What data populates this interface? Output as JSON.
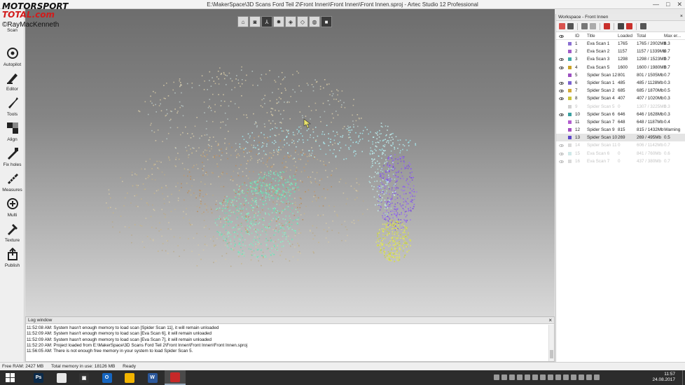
{
  "window": {
    "title": "E:\\MakerSpace\\3D Scans Ford Teil 2\\Front Innen\\Front Innen\\Front Innen.sproj - Artec Studio 12 Professional",
    "controls": [
      "—",
      "□",
      "✕"
    ]
  },
  "watermark": {
    "logo_line1": "MOTORSPORT",
    "logo_line2": "TOTAL.com",
    "credit": "©RayMacKenneth"
  },
  "left_toolbar": [
    {
      "label": "Scan",
      "icon": "scan-icon"
    },
    {
      "label": "Autopilot",
      "icon": "autopilot-icon"
    },
    {
      "label": "Editor",
      "icon": "editor-icon"
    },
    {
      "label": "Tools",
      "icon": "tools-icon"
    },
    {
      "label": "Align",
      "icon": "align-icon"
    },
    {
      "label": "Fix holes",
      "icon": "fix-holes-icon"
    },
    {
      "label": "Measures",
      "icon": "measures-icon"
    },
    {
      "label": "Multi",
      "icon": "multi-icon"
    },
    {
      "label": "Texture",
      "icon": "texture-icon"
    },
    {
      "label": "Publish",
      "icon": "publish-icon"
    }
  ],
  "view_toolbar": [
    "home-view-icon",
    "camera-icon",
    "axes-icon",
    "light-icon",
    "shaded-cube-icon",
    "wire-cube-icon",
    "sphere-icon",
    "solid-cube-icon"
  ],
  "log": {
    "title": "Log window",
    "close": "×",
    "lines": [
      "11:52:08 AM: System hasn't enough memory to load scan [Spider Scan 11], it will remain unloaded",
      "11:52:09 AM: System hasn't enough memory to load scan [Eva Scan 6], it will remain unloaded",
      "11:52:09 AM: System hasn't enough memory to load scan [Eva Scan 7], it will remain unloaded",
      "11:52:20 AM: Project loaded from E:\\MakerSpace\\3D Scans Ford Teil 2\\Front Innen\\Front Innen\\Front Innen.sproj",
      "11:56:05 AM: There is not enough free memory in your system to load Spider Scan 5."
    ]
  },
  "status": {
    "free_ram": "Free RAM: 2427 MB",
    "total_mem": "Total memory in use: 18126 MB",
    "state": "Ready"
  },
  "workspace": {
    "title": "Workspace - Front Innen",
    "close": "×",
    "columns": {
      "id": "ID",
      "title": "Title",
      "loaded": "Loaded",
      "total": "Total",
      "max": "Max er..."
    },
    "rows": [
      {
        "visible": false,
        "color": "#8a6fd1",
        "id": "1",
        "title": "Eva Scan 1",
        "loaded": "1765",
        "total": "1765 / 2002Mb",
        "max": "8.3",
        "faded": false,
        "selected": false
      },
      {
        "visible": false,
        "color": "#a05cc8",
        "id": "2",
        "title": "Eva Scan 2",
        "loaded": "1157",
        "total": "1157 / 1339Mb",
        "max": "0.7",
        "faded": false,
        "selected": false
      },
      {
        "visible": true,
        "color": "#3fa7a7",
        "id": "3",
        "title": "Eva Scan 3",
        "loaded": "1298",
        "total": "1298 / 1523Mb",
        "max": "0.7",
        "faded": false,
        "selected": false
      },
      {
        "visible": true,
        "color": "#c9a227",
        "id": "4",
        "title": "Eva Scan 5",
        "loaded": "1600",
        "total": "1600 / 1980Mb",
        "max": "0.7",
        "faded": false,
        "selected": false
      },
      {
        "visible": false,
        "color": "#9c4fc0",
        "id": "5",
        "title": "Spider Scan 12",
        "loaded": "801",
        "total": "801 / 1505Mb",
        "max": "0.7",
        "faded": false,
        "selected": false
      },
      {
        "visible": true,
        "color": "#7a62cf",
        "id": "6",
        "title": "Spider Scan 1",
        "loaded": "485",
        "total": "485 / 1128Mb",
        "max": "0.3",
        "faded": false,
        "selected": false
      },
      {
        "visible": true,
        "color": "#d1a93a",
        "id": "7",
        "title": "Spider Scan 2",
        "loaded": "685",
        "total": "685 / 1870Mb",
        "max": "0.5",
        "faded": false,
        "selected": false
      },
      {
        "visible": true,
        "color": "#c9c43a",
        "id": "8",
        "title": "Spider Scan 4",
        "loaded": "407",
        "total": "407 / 1020Mb",
        "max": "0.3",
        "faded": false,
        "selected": false
      },
      {
        "visible": false,
        "color": "#d0d0d0",
        "id": "9",
        "title": "Spider Scan 5",
        "loaded": "0",
        "total": "1307 / 3225Mb",
        "max": "0.3",
        "faded": true,
        "selected": false
      },
      {
        "visible": true,
        "color": "#3aa0a0",
        "id": "10",
        "title": "Spider Scan 6",
        "loaded": "646",
        "total": "646 / 1628Mb",
        "max": "0.3",
        "faded": false,
        "selected": false
      },
      {
        "visible": false,
        "color": "#b35fcf",
        "id": "11",
        "title": "Spider Scan 7",
        "loaded": "648",
        "total": "648 / 1187Mb",
        "max": "0.4",
        "faded": false,
        "selected": false
      },
      {
        "visible": false,
        "color": "#a34fc0",
        "id": "12",
        "title": "Spider Scan 9",
        "loaded": "815",
        "total": "815 / 1432Mb",
        "max": "Warning",
        "faded": false,
        "selected": false
      },
      {
        "visible": false,
        "color": "#5c47c8",
        "id": "13",
        "title": "Spider Scan 10",
        "loaded": "269",
        "total": "269 / 495Mb",
        "max": "0.5",
        "faded": false,
        "selected": true
      },
      {
        "visible": true,
        "color": "#d9d9d9",
        "id": "14",
        "title": "Spider Scan 11",
        "loaded": "0",
        "total": "606 / 1142Mb",
        "max": "0.7",
        "faded": true,
        "selected": false
      },
      {
        "visible": true,
        "color": "#cfe8e8",
        "id": "15",
        "title": "Eva Scan 6",
        "loaded": "0",
        "total": "841 / 760Mb",
        "max": "0.6",
        "faded": true,
        "selected": false
      },
      {
        "visible": true,
        "color": "#d9d9d9",
        "id": "16",
        "title": "Eva Scan 7",
        "loaded": "0",
        "total": "437 / 380Mb",
        "max": "0.7",
        "faded": true,
        "selected": false
      }
    ]
  },
  "taskbar": {
    "apps": [
      {
        "name": "photoshop",
        "label": "Ps",
        "color": "#0b2a4a"
      },
      {
        "name": "chrome",
        "label": "",
        "color": "#e8e8e8"
      },
      {
        "name": "app-3",
        "label": "▣",
        "color": "#333333"
      },
      {
        "name": "outlook",
        "label": "O",
        "color": "#1565c0"
      },
      {
        "name": "explorer",
        "label": "",
        "color": "#f2b400"
      },
      {
        "name": "word",
        "label": "W",
        "color": "#2b579a"
      },
      {
        "name": "artec-studio",
        "label": "",
        "color": "#c62828"
      }
    ],
    "time": "11:57",
    "date": "24.08.2017"
  }
}
